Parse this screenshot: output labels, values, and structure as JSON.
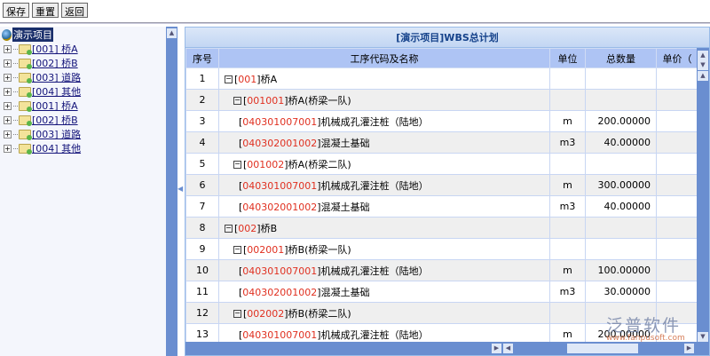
{
  "toolbar": {
    "save": "保存",
    "reset": "重置",
    "back": "返回"
  },
  "tree": {
    "root": "演示项目",
    "nodes": [
      "[001] 桥A",
      "[002] 桥B",
      "[003] 道路",
      "[004] 其他",
      "[001] 桥A",
      "[002] 桥B",
      "[003] 道路",
      "[004] 其他"
    ]
  },
  "grid": {
    "title": "[演示项目]WBS总计划",
    "columns": [
      "序号",
      "工序代码及名称",
      "单位",
      "总数量",
      "单价（"
    ],
    "rows": [
      {
        "no": "1",
        "level": 0,
        "expand": true,
        "code": "001",
        "name": "桥A",
        "unit": "",
        "qty": ""
      },
      {
        "no": "2",
        "level": 1,
        "expand": true,
        "code": "001001",
        "name": "桥A(桥梁一队)",
        "unit": "",
        "qty": ""
      },
      {
        "no": "3",
        "level": 2,
        "expand": false,
        "code": "040301007001",
        "name": "机械成孔灌注桩（陆地）",
        "unit": "m",
        "qty": "200.00000"
      },
      {
        "no": "4",
        "level": 2,
        "expand": false,
        "code": "040302001002",
        "name": "混凝土基础",
        "unit": "m3",
        "qty": "40.00000"
      },
      {
        "no": "5",
        "level": 1,
        "expand": true,
        "code": "001002",
        "name": "桥A(桥梁二队)",
        "unit": "",
        "qty": ""
      },
      {
        "no": "6",
        "level": 2,
        "expand": false,
        "code": "040301007001",
        "name": "机械成孔灌注桩（陆地）",
        "unit": "m",
        "qty": "300.00000"
      },
      {
        "no": "7",
        "level": 2,
        "expand": false,
        "code": "040302001002",
        "name": "混凝土基础",
        "unit": "m3",
        "qty": "40.00000"
      },
      {
        "no": "8",
        "level": 0,
        "expand": true,
        "code": "002",
        "name": "桥B",
        "unit": "",
        "qty": ""
      },
      {
        "no": "9",
        "level": 1,
        "expand": true,
        "code": "002001",
        "name": "桥B(桥梁一队)",
        "unit": "",
        "qty": ""
      },
      {
        "no": "10",
        "level": 2,
        "expand": false,
        "code": "040301007001",
        "name": "机械成孔灌注桩（陆地）",
        "unit": "m",
        "qty": "100.00000"
      },
      {
        "no": "11",
        "level": 2,
        "expand": false,
        "code": "040302001002",
        "name": "混凝土基础",
        "unit": "m3",
        "qty": "30.00000"
      },
      {
        "no": "12",
        "level": 1,
        "expand": true,
        "code": "002002",
        "name": "桥B(桥梁二队)",
        "unit": "",
        "qty": ""
      },
      {
        "no": "13",
        "level": 2,
        "expand": false,
        "code": "040301007001",
        "name": "机械成孔灌注桩（陆地）",
        "unit": "m",
        "qty": "200.00000"
      }
    ]
  },
  "watermark": {
    "name": "泛普软件",
    "url": "www.fanpusoft.com"
  }
}
